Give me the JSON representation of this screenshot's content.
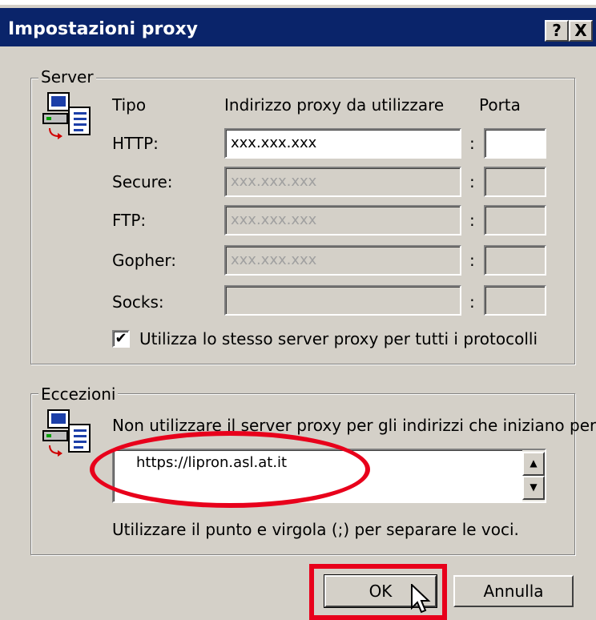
{
  "title": "Impostazioni proxy",
  "titlebar_buttons": {
    "help": "?",
    "close": "X"
  },
  "server": {
    "legend": "Server",
    "col_type": "Tipo",
    "col_address": "Indirizzo proxy da utilizzare",
    "col_port": "Porta",
    "colon": ":",
    "rows": [
      {
        "label": "HTTP:",
        "address": "xxx.xxx.xxx",
        "port": ""
      },
      {
        "label": "Secure:",
        "address": "xxx.xxx.xxx",
        "port": ""
      },
      {
        "label": "FTP:",
        "address": "xxx.xxx.xxx",
        "port": ""
      },
      {
        "label": "Gopher:",
        "address": "xxx.xxx.xxx",
        "port": ""
      },
      {
        "label": "Socks:",
        "address": "",
        "port": ""
      }
    ],
    "same_proxy_label": "Utilizza lo stesso server proxy per tutti i protocolli",
    "same_proxy_checked": true
  },
  "exceptions": {
    "legend": "Eccezioni",
    "instruction": "Non utilizzare il server proxy per gli indirizzi che iniziano per:",
    "value": "https://lipron.asl.at.it",
    "hint": "Utilizzare il punto e virgola (;) per separare le voci."
  },
  "buttons": {
    "ok": "OK",
    "cancel": "Annulla"
  },
  "colors": {
    "titlebar": "#0a246a",
    "dialog_bg": "#d4d0c8",
    "highlight": "#e8001b"
  },
  "icons": {
    "server_icon": "network-computer-icon",
    "exceptions_icon": "network-computer-icon",
    "cursor": "mouse-pointer-icon"
  }
}
